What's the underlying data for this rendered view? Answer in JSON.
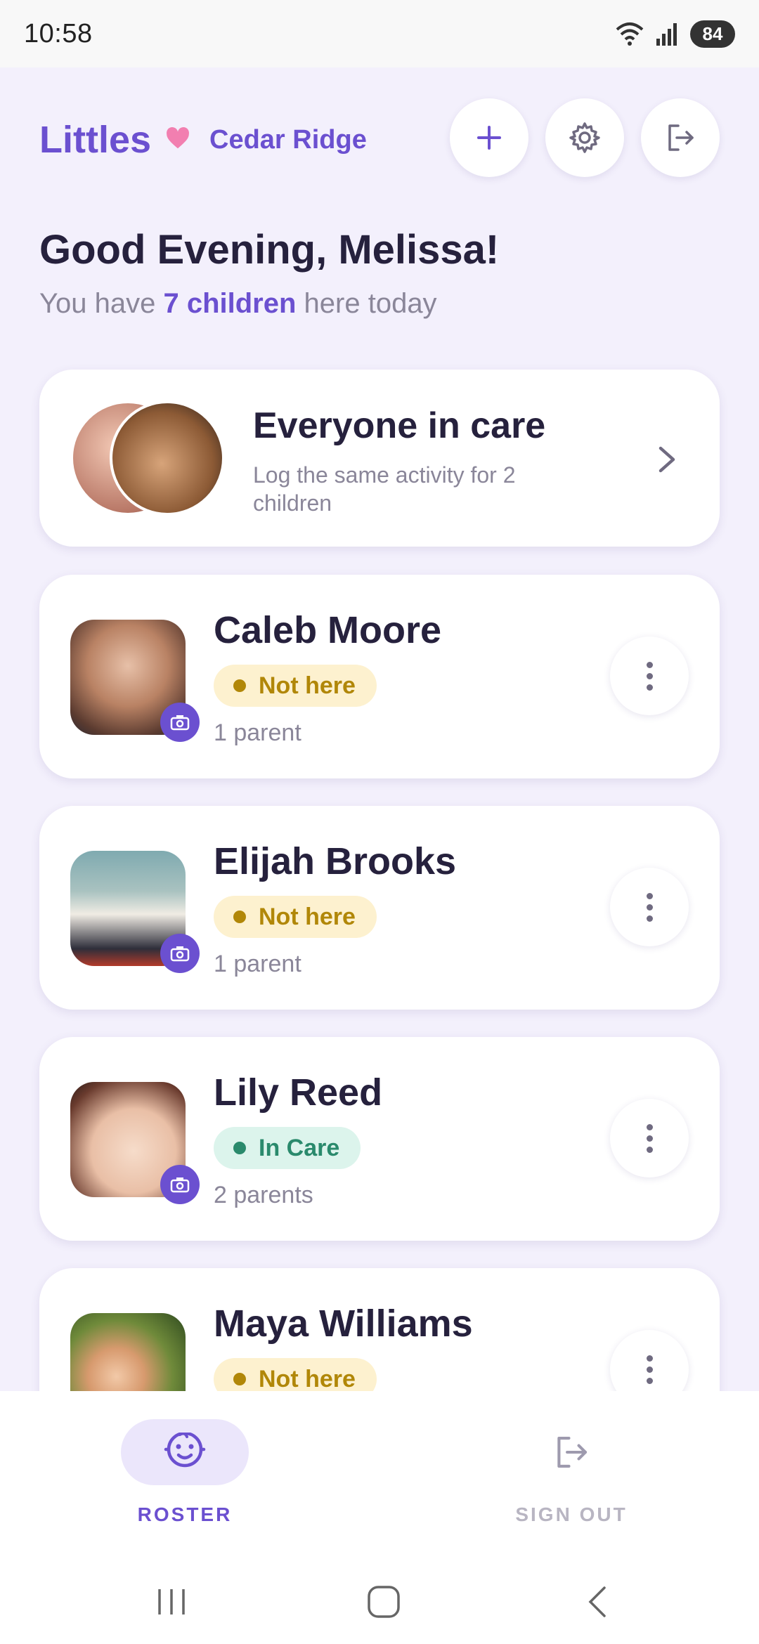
{
  "status_bar": {
    "time": "10:58",
    "battery": "84",
    "wifi_icon": "wifi-icon",
    "signal_icon": "signal-icon"
  },
  "header": {
    "brand": "Littles",
    "center_name": "Cedar Ridge",
    "buttons": {
      "add_icon": "plus-icon",
      "settings_icon": "gear-icon",
      "exit_icon": "exit-icon"
    }
  },
  "greeting": {
    "title": "Good Evening, Melissa!",
    "sub_prefix": "You have ",
    "sub_highlight": "7 children",
    "sub_suffix": " here today"
  },
  "everyone_card": {
    "title": "Everyone in care",
    "description": "Log the same activity for 2 children"
  },
  "children": [
    {
      "name": "Caleb Moore",
      "status": "Not here",
      "parents": "1 parent"
    },
    {
      "name": "Elijah Brooks",
      "status": "Not here",
      "parents": "1 parent"
    },
    {
      "name": "Lily Reed",
      "status": "In Care",
      "parents": "2 parents"
    },
    {
      "name": "Maya Williams",
      "status": "Not here",
      "parents": ""
    }
  ],
  "bottom_nav": {
    "roster_label": "ROSTER",
    "signout_label": "SIGN OUT"
  },
  "colors": {
    "accent": "#6b50d0",
    "heart": "#f27fb0",
    "not_here": "#b18708",
    "in_care": "#2a8a6c",
    "background": "#f3f0fc"
  }
}
